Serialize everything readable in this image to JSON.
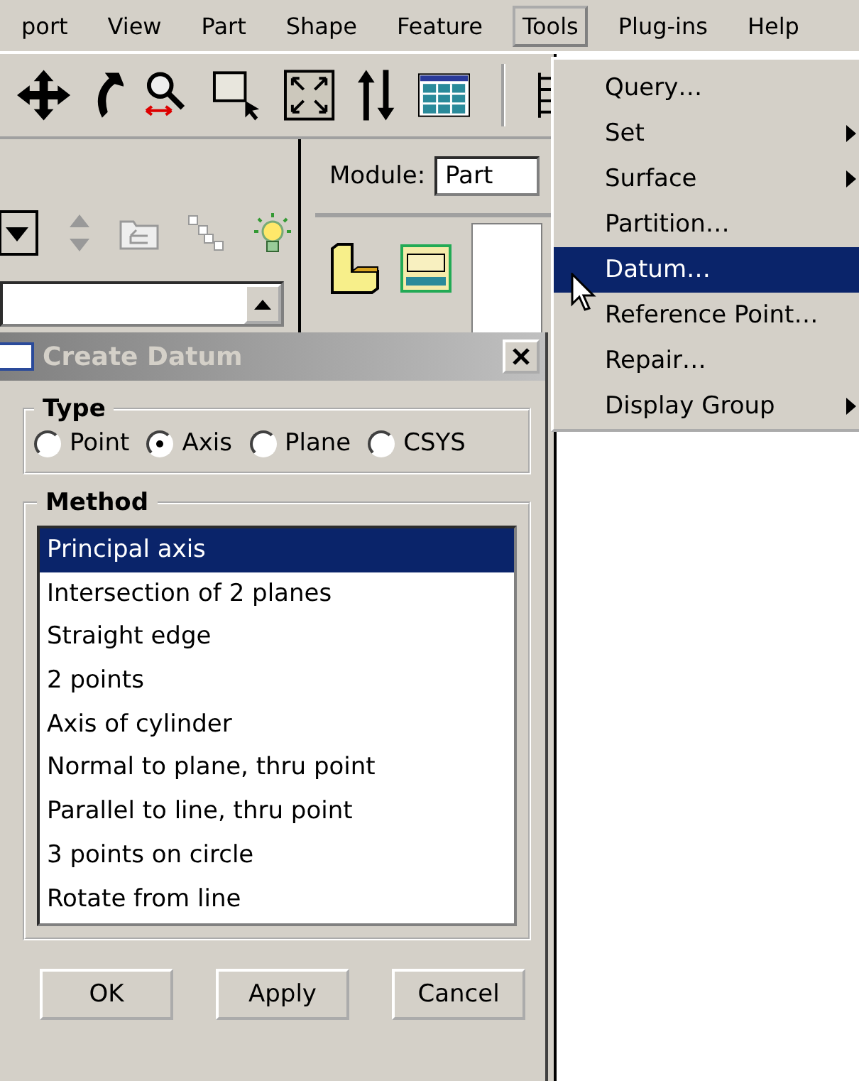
{
  "menubar": [
    {
      "label": "port",
      "selected": false
    },
    {
      "label": "View",
      "selected": false
    },
    {
      "label": "Part",
      "selected": false
    },
    {
      "label": "Shape",
      "selected": false
    },
    {
      "label": "Feature",
      "selected": false
    },
    {
      "label": "Tools",
      "selected": true
    },
    {
      "label": "Plug-ins",
      "selected": false
    },
    {
      "label": "Help",
      "selected": false
    }
  ],
  "module": {
    "label": "Module:",
    "value": "Part"
  },
  "tools_menu": [
    {
      "label": "Query…",
      "submenu": false,
      "selected": false
    },
    {
      "label": "Set",
      "submenu": true,
      "selected": false
    },
    {
      "label": "Surface",
      "submenu": true,
      "selected": false
    },
    {
      "label": "Partition…",
      "submenu": false,
      "selected": false
    },
    {
      "label": "Datum…",
      "submenu": false,
      "selected": true
    },
    {
      "label": "Reference Point…",
      "submenu": false,
      "selected": false
    },
    {
      "label": "Repair…",
      "submenu": false,
      "selected": false
    },
    {
      "label": "Display Group",
      "submenu": true,
      "selected": false
    }
  ],
  "dialog": {
    "title": "Create Datum",
    "type_group": {
      "title": "Type",
      "options": [
        {
          "label": "Point",
          "selected": false
        },
        {
          "label": "Axis",
          "selected": true
        },
        {
          "label": "Plane",
          "selected": false
        },
        {
          "label": "CSYS",
          "selected": false
        }
      ]
    },
    "method_group": {
      "title": "Method",
      "items": [
        {
          "label": "Principal axis",
          "selected": true
        },
        {
          "label": "Intersection of 2 planes",
          "selected": false
        },
        {
          "label": "Straight edge",
          "selected": false
        },
        {
          "label": "2 points",
          "selected": false
        },
        {
          "label": "Axis of cylinder",
          "selected": false
        },
        {
          "label": "Normal to plane, thru point",
          "selected": false
        },
        {
          "label": "Parallel to line, thru point",
          "selected": false
        },
        {
          "label": "3 points on circle",
          "selected": false
        },
        {
          "label": "Rotate from line",
          "selected": false
        }
      ]
    },
    "buttons": [
      "OK",
      "Apply",
      "Cancel"
    ]
  }
}
